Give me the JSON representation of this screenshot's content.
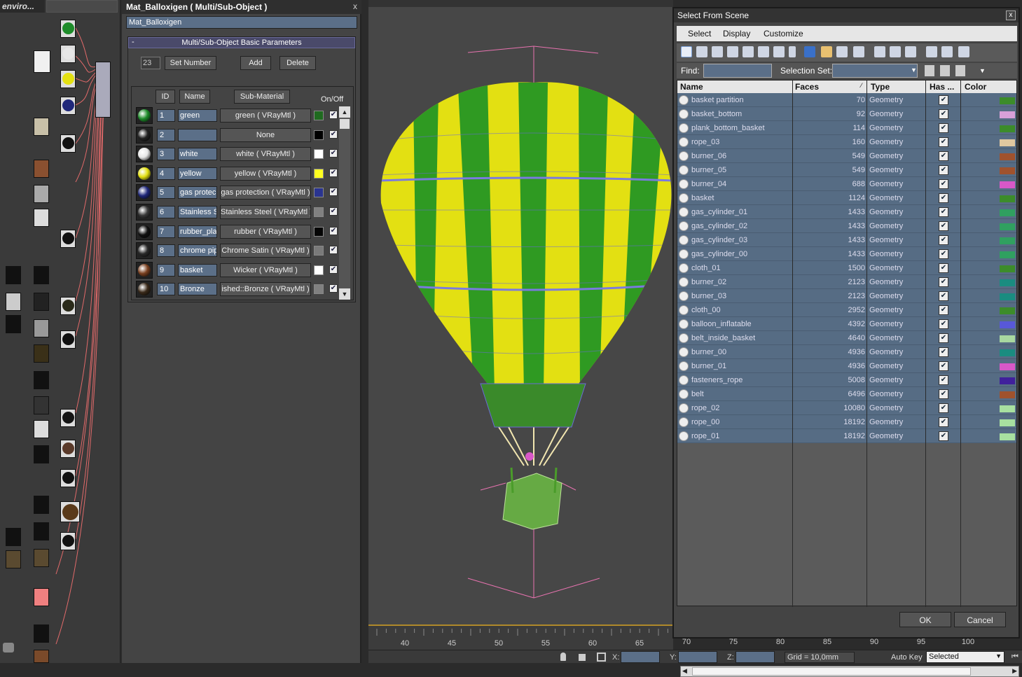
{
  "node_editor": {
    "title": "enviro..."
  },
  "material_editor": {
    "title": "Mat_Balloxigen  ( Multi/Sub-Object )",
    "close": "x",
    "name_field": "Mat_Balloxigen",
    "rollout_title": "Multi/Sub-Object Basic Parameters",
    "rollout_toggle": "-",
    "set_number_value": "23",
    "set_number_label": "Set Number",
    "add_label": "Add",
    "delete_label": "Delete",
    "col_id": "ID",
    "col_name": "Name",
    "col_submaterial": "Sub-Material",
    "col_onoff": "On/Off",
    "rows": [
      {
        "id": "1",
        "name": "green",
        "sub": "green  ( VRayMtl )",
        "color": "#1f6a1f",
        "sphere": "#1e8c2a",
        "on": "✔"
      },
      {
        "id": "2",
        "name": "",
        "sub": "None",
        "color": "#000000",
        "sphere": "#222222",
        "on": "✔"
      },
      {
        "id": "3",
        "name": "white",
        "sub": "white  ( VRayMtl )",
        "color": "#ffffff",
        "sphere": "#e6e6e6",
        "on": "✔"
      },
      {
        "id": "4",
        "name": "yellow",
        "sub": "yellow  ( VRayMtl )",
        "color": "#ffff20",
        "sphere": "#e3e012",
        "on": "✔"
      },
      {
        "id": "5",
        "name": "gas protec",
        "sub": "gas protection  ( VRayMtl )",
        "color": "#2a3490",
        "sphere": "#20287a",
        "on": "✔"
      },
      {
        "id": "6",
        "name": "Stainless S",
        "sub": "Stainless Steel  ( VRayMtl )",
        "color": "#808080",
        "sphere": "#3a3a3a",
        "on": "✔"
      },
      {
        "id": "7",
        "name": "rubber_pla",
        "sub": "rubber  ( VRayMtl )",
        "color": "#050505",
        "sphere": "#111111",
        "on": "✔"
      },
      {
        "id": "8",
        "name": "chrome pip",
        "sub": "Chrome Satin  ( VRayMtl )",
        "color": "#7a7a7a",
        "sphere": "#2a2a2a",
        "on": "✔"
      },
      {
        "id": "9",
        "name": "basket",
        "sub": "Wicker  ( VRayMtl )",
        "color": "#ffffff",
        "sphere": "#7a4020",
        "on": "✔"
      },
      {
        "id": "10",
        "name": "Bronze",
        "sub": "ished::Bronze  ( VRayMtl )",
        "color": "#808080",
        "sphere": "#3a2a1a",
        "on": "✔"
      }
    ]
  },
  "viewport": {
    "ruler_ticks": [
      "40",
      "45",
      "50",
      "55",
      "60",
      "65",
      "70",
      "75",
      "80",
      "85",
      "90",
      "95",
      "100"
    ]
  },
  "status": {
    "x_label": "X:",
    "y_label": "Y:",
    "z_label": "Z:",
    "grid": "Grid = 10,0mm",
    "autokey": "Auto Key",
    "selected": "Selected"
  },
  "dialog": {
    "title": "Select From Scene",
    "close": "x",
    "menu": [
      "Select",
      "Display",
      "Customize"
    ],
    "find_label": "Find:",
    "selection_set_label": "Selection Set:",
    "col_name": "Name",
    "col_faces": "Faces",
    "col_type": "Type",
    "col_has": "Has ...",
    "col_color": "Color",
    "ok": "OK",
    "cancel": "Cancel",
    "rows": [
      {
        "name": "basket partition",
        "faces": "70",
        "type": "Geometry",
        "color": "#3c8c2a"
      },
      {
        "name": "basket_bottom",
        "faces": "92",
        "type": "Geometry",
        "color": "#d9a0d9"
      },
      {
        "name": "plank_bottom_basket",
        "faces": "114",
        "type": "Geometry",
        "color": "#3c8c2a"
      },
      {
        "name": "rope_03",
        "faces": "160",
        "type": "Geometry",
        "color": "#e0c8a0"
      },
      {
        "name": "burner_06",
        "faces": "549",
        "type": "Geometry",
        "color": "#a0522d"
      },
      {
        "name": "burner_05",
        "faces": "549",
        "type": "Geometry",
        "color": "#a0522d"
      },
      {
        "name": "burner_04",
        "faces": "688",
        "type": "Geometry",
        "color": "#d858c8"
      },
      {
        "name": "basket",
        "faces": "1124",
        "type": "Geometry",
        "color": "#3c8c2a"
      },
      {
        "name": "gas_cylinder_01",
        "faces": "1433",
        "type": "Geometry",
        "color": "#30a060"
      },
      {
        "name": "gas_cylinder_02",
        "faces": "1433",
        "type": "Geometry",
        "color": "#30a060"
      },
      {
        "name": "gas_cylinder_03",
        "faces": "1433",
        "type": "Geometry",
        "color": "#30a060"
      },
      {
        "name": "gas_cylinder_00",
        "faces": "1433",
        "type": "Geometry",
        "color": "#30a060"
      },
      {
        "name": "cloth_01",
        "faces": "1500",
        "type": "Geometry",
        "color": "#3c8c2a"
      },
      {
        "name": "burner_02",
        "faces": "2123",
        "type": "Geometry",
        "color": "#1a8c80"
      },
      {
        "name": "burner_03",
        "faces": "2123",
        "type": "Geometry",
        "color": "#1a8c80"
      },
      {
        "name": "cloth_00",
        "faces": "2952",
        "type": "Geometry",
        "color": "#3c8c2a"
      },
      {
        "name": "balloon_inflatable",
        "faces": "4392",
        "type": "Geometry",
        "color": "#5858d8"
      },
      {
        "name": "belt_inside_basket",
        "faces": "4640",
        "type": "Geometry",
        "color": "#a8d8a0"
      },
      {
        "name": "burner_00",
        "faces": "4936",
        "type": "Geometry",
        "color": "#1a8c80"
      },
      {
        "name": "burner_01",
        "faces": "4936",
        "type": "Geometry",
        "color": "#d858c8"
      },
      {
        "name": "fasteners_rope",
        "faces": "5008",
        "type": "Geometry",
        "color": "#40209c"
      },
      {
        "name": "belt",
        "faces": "6496",
        "type": "Geometry",
        "color": "#a0522d"
      },
      {
        "name": "rope_02",
        "faces": "10080",
        "type": "Geometry",
        "color": "#a8e0a0"
      },
      {
        "name": "rope_00",
        "faces": "18192",
        "type": "Geometry",
        "color": "#a8e0a0"
      },
      {
        "name": "rope_01",
        "faces": "18192",
        "type": "Geometry",
        "color": "#a8e0a0"
      }
    ]
  }
}
